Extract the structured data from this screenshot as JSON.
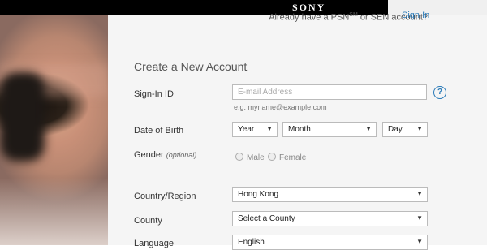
{
  "header": {
    "logo": "SONY"
  },
  "account_prompt": {
    "prefix": "Already have a PSN",
    "sup": "SM",
    "suffix": " or SEN account?",
    "signin_label": "Sign In"
  },
  "form": {
    "title": "Create a New Account",
    "signin_id": {
      "label": "Sign-In ID",
      "placeholder": "E-mail Address",
      "hint": "e.g. myname@example.com"
    },
    "dob": {
      "label": "Date of Birth",
      "year": "Year",
      "month": "Month",
      "day": "Day"
    },
    "gender": {
      "label": "Gender",
      "optional": "(optional)",
      "male": "Male",
      "female": "Female"
    },
    "country": {
      "label": "Country/Region",
      "value": "Hong Kong"
    },
    "county": {
      "label": "County",
      "value": "Select a County"
    },
    "language": {
      "label": "Language",
      "value": "English"
    }
  },
  "icons": {
    "help": "?",
    "dropdown": "▼"
  },
  "colors": {
    "accent": "#2a7ab8"
  }
}
